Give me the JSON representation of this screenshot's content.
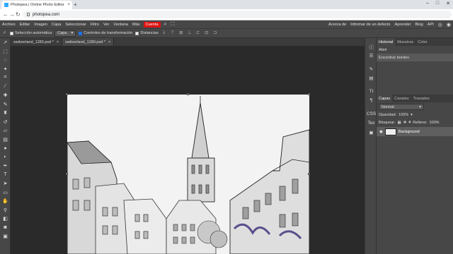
{
  "browser": {
    "tab_title": "Photopea | Online Photo Editor",
    "tab_close": "×",
    "new_tab": "+",
    "url": "photopea.com",
    "win_min": "–",
    "win_max": "□",
    "win_close": "✕"
  },
  "menu": {
    "items": [
      "Archivo",
      "Editar",
      "Imagen",
      "Capa",
      "Seleccionar",
      "Filtro",
      "Ver",
      "Ventana",
      "Más"
    ],
    "account": "Cuenta",
    "right": [
      "Acerca de",
      "Informar de un defecto",
      "Aprender",
      "Blog",
      "API"
    ]
  },
  "options": {
    "auto_select_label": "Selección automática",
    "layer_select": "Capa",
    "transform_label": "Controles de transformación",
    "distances_label": "Distancias"
  },
  "documents": [
    {
      "name": "switzerland_1280.psd *",
      "close": "×"
    },
    {
      "name": "switzerland_1280.psd *",
      "close": "×"
    }
  ],
  "history_panel": {
    "tabs": [
      "Historial",
      "Muestras",
      "Color"
    ],
    "entries": [
      "Abrir",
      "Encontrar bordes"
    ]
  },
  "layers_panel": {
    "tabs": [
      "Capas",
      "Canales",
      "Trazados"
    ],
    "blend_mode": "Normal",
    "opacity_label": "Opacidad:",
    "opacity_value": "100%",
    "lock_label": "Bloquear:",
    "fill_label": "Relleno:",
    "fill_value": "100%",
    "layer_name": "Background"
  },
  "side_labels": {
    "css": "CSS",
    "tex": "Tex"
  },
  "colors": {
    "accent": "#1a73e8",
    "account_red": "#dd1111",
    "canvas_bg": "#2a2a2a",
    "ui_bg": "#474747"
  }
}
